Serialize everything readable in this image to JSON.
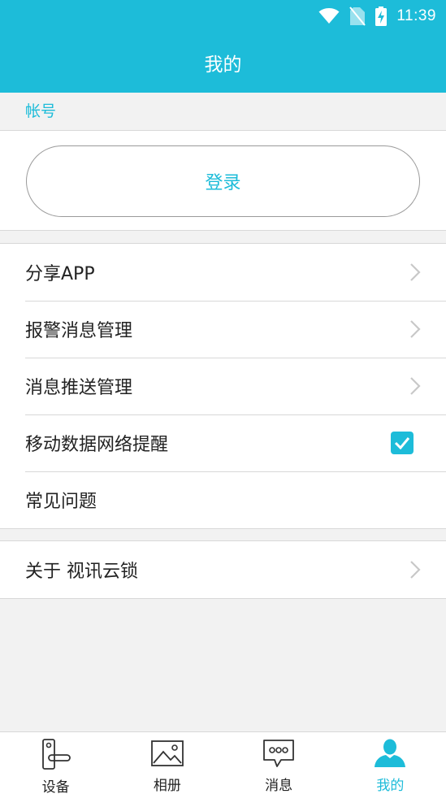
{
  "status_bar": {
    "time": "11:39",
    "icons": [
      "wifi-icon",
      "no-sim-icon",
      "battery-charging-icon"
    ]
  },
  "header": {
    "title": "我的"
  },
  "account_section": {
    "label": "帐号",
    "login_label": "登录"
  },
  "menu_group_1": [
    {
      "label": "分享APP",
      "accessory": "chevron"
    },
    {
      "label": "报警消息管理",
      "accessory": "chevron"
    },
    {
      "label": "消息推送管理",
      "accessory": "chevron"
    },
    {
      "label": "移动数据网络提醒",
      "accessory": "checkbox",
      "checked": true
    },
    {
      "label": "常见问题",
      "accessory": "none"
    }
  ],
  "menu_group_2": [
    {
      "label": "关于 视讯云锁",
      "accessory": "chevron"
    }
  ],
  "tabbar": {
    "tabs": [
      {
        "label": "设备",
        "icon": "door-lock-icon",
        "active": false
      },
      {
        "label": "相册",
        "icon": "photo-album-icon",
        "active": false
      },
      {
        "label": "消息",
        "icon": "message-icon",
        "active": false
      },
      {
        "label": "我的",
        "icon": "person-icon",
        "active": true
      }
    ]
  },
  "colors": {
    "accent": "#1dbcd9",
    "background": "#f2f2f2",
    "divider": "#d8d8d8"
  }
}
